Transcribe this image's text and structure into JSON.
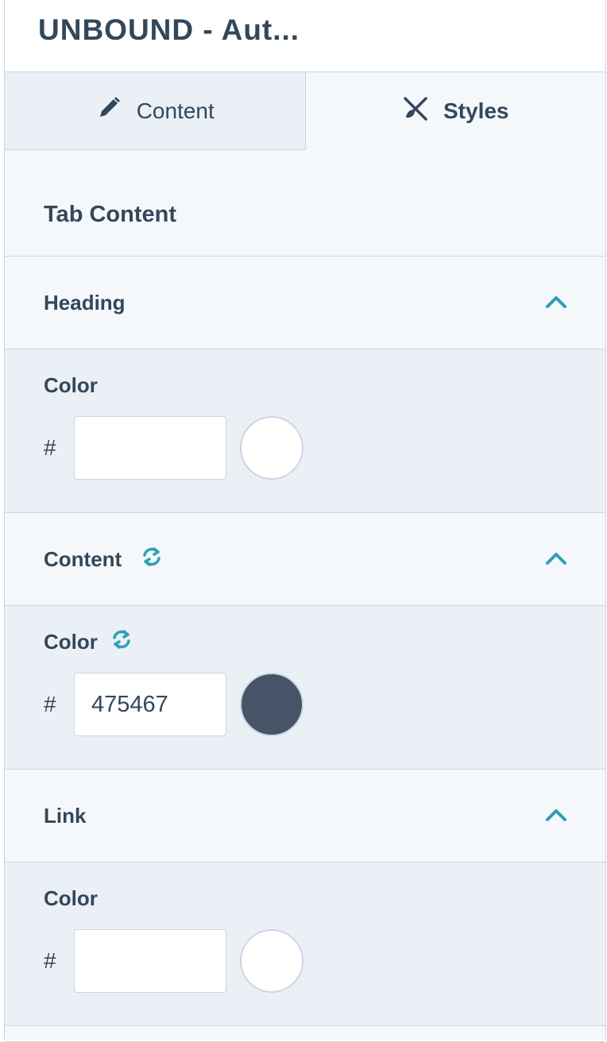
{
  "header": {
    "title": "UNBOUND - Aut..."
  },
  "tabs": [
    {
      "label": "Content",
      "icon": "pencil-icon",
      "active": false
    },
    {
      "label": "Styles",
      "icon": "brush-icon",
      "active": true
    }
  ],
  "section": {
    "title": "Tab Content"
  },
  "accordions": [
    {
      "title": "Heading",
      "has_sync": false,
      "field_label": "Color",
      "field_sync": false,
      "hash": "#",
      "value": "",
      "swatch": "#ffffff"
    },
    {
      "title": "Content",
      "has_sync": true,
      "field_label": "Color",
      "field_sync": true,
      "hash": "#",
      "value": "475467",
      "swatch": "#475467"
    },
    {
      "title": "Link",
      "has_sync": false,
      "field_label": "Color",
      "field_sync": false,
      "hash": "#",
      "value": "",
      "swatch": "#ffffff"
    }
  ],
  "colors": {
    "accent": "#2e9fb8",
    "text": "#33475b",
    "border": "#cbd6e2",
    "body_bg": "#eaf0f6",
    "panel_bg": "#f5f8fa"
  }
}
